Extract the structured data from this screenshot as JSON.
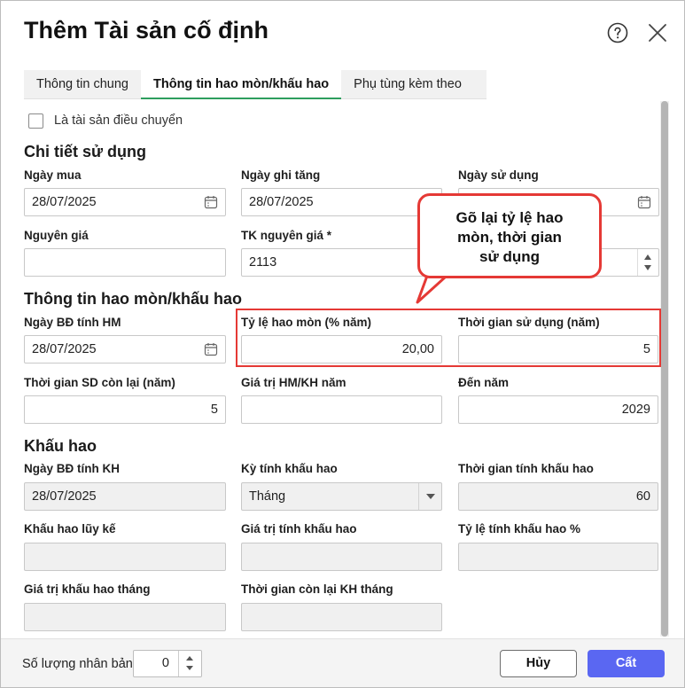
{
  "dialog": {
    "title": "Thêm Tài sản cố định"
  },
  "tabs": [
    {
      "label": "Thông tin chung"
    },
    {
      "label": "Thông tin hao mòn/khấu hao"
    },
    {
      "label": "Phụ tùng kèm theo"
    }
  ],
  "transfer_checkbox": {
    "label": "Là tài sản điều chuyển",
    "checked": false
  },
  "usage_details": {
    "title": "Chi tiết sử dụng",
    "purchase_date": {
      "label": "Ngày mua",
      "value": "28/07/2025"
    },
    "increase_date": {
      "label": "Ngày ghi tăng",
      "value": "28/07/2025"
    },
    "use_date": {
      "label": "Ngày sử dụng",
      "value": ""
    },
    "original_cost": {
      "label": "Nguyên giá",
      "value": ""
    },
    "cost_account": {
      "label": "TK nguyên giá *",
      "value": "2113"
    },
    "unknown_spinner": {
      "value": ""
    }
  },
  "depreciation_info": {
    "title": "Thông tin hao mòn/khấu hao",
    "start_date_hm": {
      "label": "Ngày BĐ tính HM",
      "value": "28/07/2025"
    },
    "wear_rate": {
      "label": "Tỷ lệ hao mòn (% năm)",
      "value": "20,00"
    },
    "useful_life": {
      "label": "Thời gian sử dụng (năm)",
      "value": "5"
    },
    "remaining_life": {
      "label": "Thời gian SD còn lại (năm)",
      "value": "5"
    },
    "annual_value": {
      "label": "Giá trị HM/KH năm",
      "value": ""
    },
    "to_year": {
      "label": "Đến năm",
      "value": "2029"
    }
  },
  "amortization": {
    "title": "Khấu hao",
    "start_date_kh": {
      "label": "Ngày BĐ tính KH",
      "value": "28/07/2025"
    },
    "period": {
      "label": "Kỳ tính khấu hao",
      "value": "Tháng"
    },
    "period_months": {
      "label": "Thời gian tính khấu hao",
      "value": "60"
    },
    "accumulated": {
      "label": "Khấu hao lũy kế",
      "value": ""
    },
    "depreciable_value": {
      "label": "Giá trị tính khấu hao",
      "value": ""
    },
    "rate_percent": {
      "label": "Tỷ lệ tính khấu hao %",
      "value": ""
    },
    "monthly_value": {
      "label": "Giá trị khấu hao tháng",
      "value": ""
    },
    "remaining_months": {
      "label": "Thời gian còn lại KH tháng",
      "value": ""
    }
  },
  "callout": {
    "line1": "Gõ lại tỷ lệ hao",
    "line2": "mòn, thời gian",
    "line3": "sử dụng"
  },
  "footer": {
    "copies_label": "Số lượng nhân bản",
    "copies_value": "0",
    "cancel_label": "Hủy",
    "save_label": "Cất"
  },
  "colors": {
    "accent": "#5a67f2",
    "tab_active_underline": "#2e9e5e",
    "highlight": "#e53935",
    "plus_icon": "#2e9e3e"
  }
}
